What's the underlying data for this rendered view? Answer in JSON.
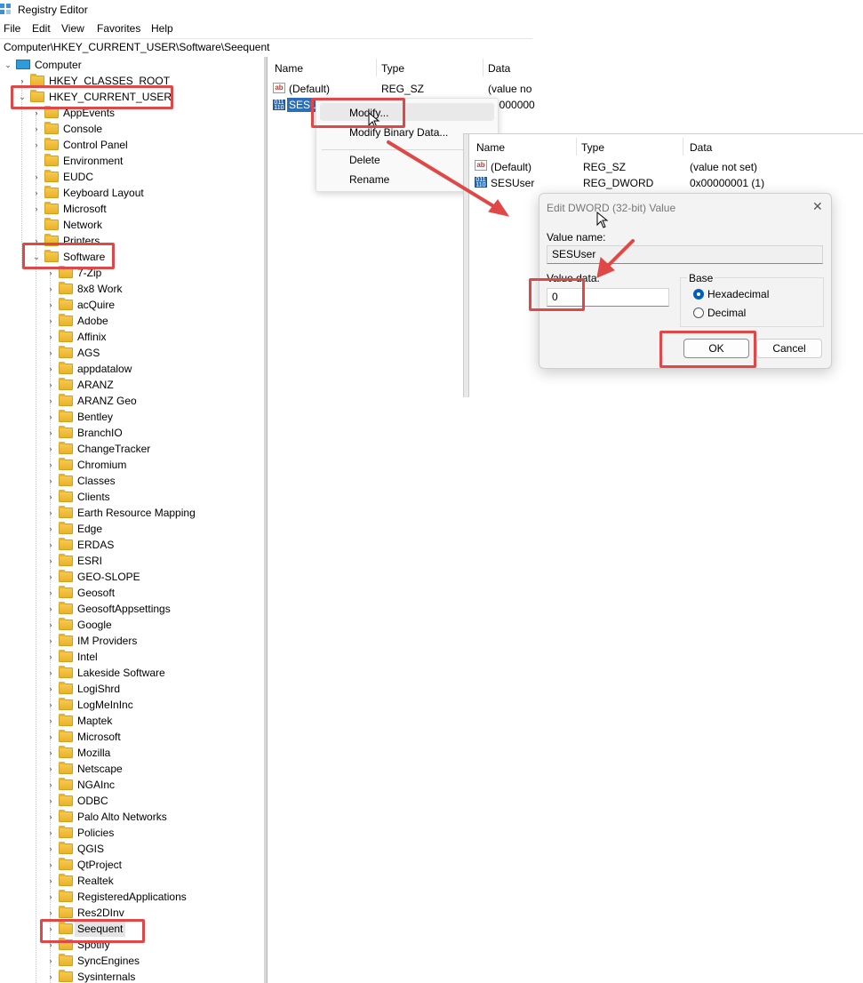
{
  "window": {
    "title": "Registry Editor"
  },
  "menu": [
    "File",
    "Edit",
    "View",
    "Favorites",
    "Help"
  ],
  "address": "Computer\\HKEY_CURRENT_USER\\Software\\Seequent",
  "tree": {
    "root": "Computer",
    "hives": [
      "HKEY_CLASSES_ROOT",
      "HKEY_CURRENT_USER"
    ],
    "hkcu_children": [
      "AppEvents",
      "Console",
      "Control Panel",
      "Environment",
      "EUDC",
      "Keyboard Layout",
      "Microsoft",
      "Network",
      "Printers",
      "Software"
    ],
    "software_children": [
      "7-Zip",
      "8x8 Work",
      "acQuire",
      "Adobe",
      "Affinix",
      "AGS",
      "appdatalow",
      "ARANZ",
      "ARANZ Geo",
      "Bentley",
      "BranchIO",
      "ChangeTracker",
      "Chromium",
      "Classes",
      "Clients",
      "Earth Resource Mapping",
      "Edge",
      "ERDAS",
      "ESRI",
      "GEO-SLOPE",
      "Geosoft",
      "GeosoftAppsettings",
      "Google",
      "IM Providers",
      "Intel",
      "Lakeside Software",
      "LogiShrd",
      "LogMeInInc",
      "Maptek",
      "Microsoft",
      "Mozilla",
      "Netscape",
      "NGAInc",
      "ODBC",
      "Palo Alto Networks",
      "Policies",
      "QGIS",
      "QtProject",
      "Realtek",
      "RegisteredApplications",
      "Res2DInv",
      "Seequent",
      "Spotify",
      "SyncEngines",
      "Sysinternals"
    ]
  },
  "values_pane": {
    "headers": {
      "name": "Name",
      "type": "Type",
      "data": "Data"
    },
    "rows": [
      {
        "name": "(Default)",
        "type": "REG_SZ",
        "data": "(value no"
      },
      {
        "name": "SESU",
        "type": "",
        "data": "0000000"
      }
    ]
  },
  "context_menu": {
    "modify": "Modify...",
    "modify_binary": "Modify Binary Data...",
    "delete": "Delete",
    "rename": "Rename"
  },
  "values_pane2": {
    "headers": {
      "name": "Name",
      "type": "Type",
      "data": "Data"
    },
    "rows": [
      {
        "name": "(Default)",
        "type": "REG_SZ",
        "data": "(value not set)"
      },
      {
        "name": "SESUser",
        "type": "REG_DWORD",
        "data": "0x00000001 (1)"
      }
    ]
  },
  "dialog": {
    "title": "Edit DWORD (32-bit) Value",
    "value_name_label": "Value name:",
    "value_name": "SESUser",
    "value_data_label": "Value data:",
    "value_data": "0",
    "base_label": "Base",
    "hex_label": "Hexadecimal",
    "dec_label": "Decimal",
    "ok": "OK",
    "cancel": "Cancel"
  },
  "annotation_color": "#e04848"
}
